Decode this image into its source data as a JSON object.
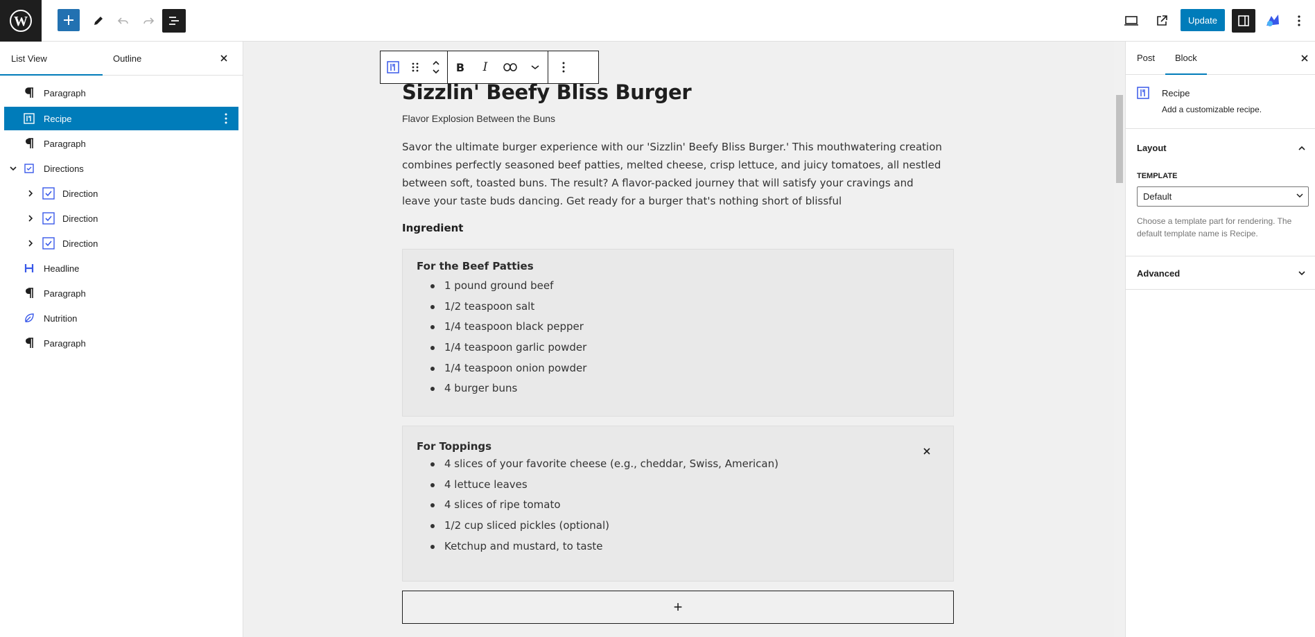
{
  "toolbar": {
    "update_label": "Update"
  },
  "left_panel": {
    "tabs": [
      {
        "label": "List View"
      },
      {
        "label": "Outline"
      }
    ],
    "items": [
      {
        "label": "Paragraph",
        "icon": "paragraph-icon"
      },
      {
        "label": "Recipe",
        "icon": "recipe-icon"
      },
      {
        "label": "Paragraph",
        "icon": "paragraph-icon"
      },
      {
        "label": "Directions",
        "icon": "directions-icon"
      },
      {
        "label": "Direction",
        "icon": "checkbox-icon"
      },
      {
        "label": "Direction",
        "icon": "checkbox-icon"
      },
      {
        "label": "Direction",
        "icon": "checkbox-icon"
      },
      {
        "label": "Headline",
        "icon": "heading-icon"
      },
      {
        "label": "Paragraph",
        "icon": "paragraph-icon"
      },
      {
        "label": "Nutrition",
        "icon": "nutrition-icon"
      },
      {
        "label": "Paragraph",
        "icon": "paragraph-icon"
      }
    ]
  },
  "content": {
    "title": "Sizzlin' Beefy Bliss Burger",
    "subtitle": "Flavor Explosion Between the Buns",
    "intro": "Savor the ultimate burger experience with our 'Sizzlin' Beefy Bliss Burger.' This mouthwatering creation combines perfectly seasoned beef patties, melted cheese, crisp lettuce, and juicy tomatoes, all nestled between soft, toasted buns. The result? A flavor-packed journey that will satisfy your cravings and leave your taste buds dancing. Get ready for a burger that's nothing short of blissful",
    "ingredient_heading": "Ingredient",
    "groups": [
      {
        "title": "For the Beef Patties",
        "items": [
          "1 pound ground beef",
          "1/2 teaspoon salt",
          "1/4 teaspoon black pepper",
          "1/4 teaspoon garlic powder",
          "1/4 teaspoon onion powder",
          "4 burger buns"
        ]
      },
      {
        "title": "For Toppings",
        "items": [
          "4 slices of your favorite cheese (e.g., cheddar, Swiss, American)",
          "4 lettuce leaves",
          "4 slices of ripe tomato",
          "1/2 cup sliced pickles (optional)",
          "Ketchup and mustard, to taste"
        ]
      }
    ],
    "appender_label": "+"
  },
  "right_panel": {
    "tabs": [
      {
        "label": "Post"
      },
      {
        "label": "Block"
      }
    ],
    "block_name": "Recipe",
    "block_description": "Add a customizable recipe.",
    "layout_title": "Layout",
    "template_label": "Template",
    "template_value": "Default",
    "template_help": "Choose a template part for rendering. The default template name is Recipe.",
    "advanced_title": "Advanced"
  },
  "colors": {
    "accent": "#007cba",
    "dark": "#1e1e1e",
    "canvas": "#f0f0f0"
  }
}
